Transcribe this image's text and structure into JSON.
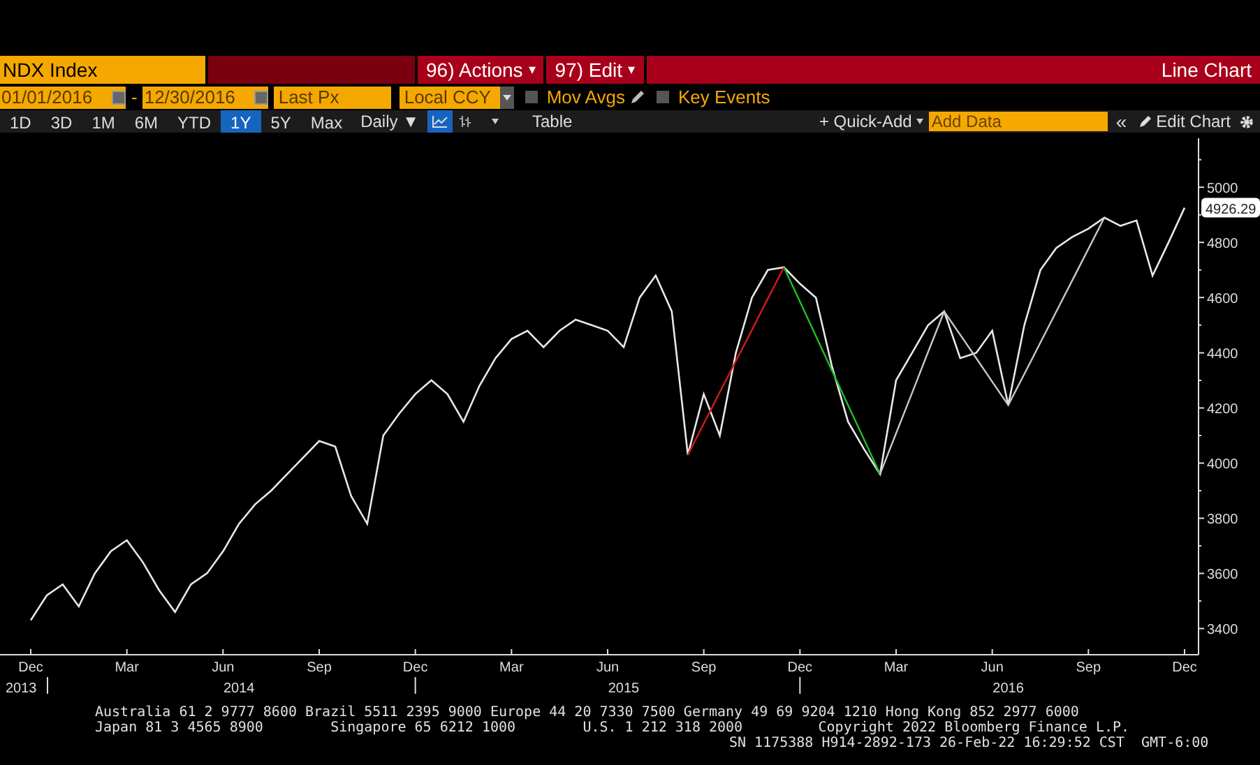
{
  "header": {
    "security": "NDX Index",
    "actions": "96) Actions",
    "edit": "97) Edit",
    "title": "Line Chart",
    "menu_caret": "▾"
  },
  "settings": {
    "start_date": "01/01/2016",
    "separator": "-",
    "end_date": "12/30/2016",
    "price_field": "Last Px",
    "currency": "Local CCY",
    "options": [
      {
        "label": "Mov Avgs",
        "checked": false
      },
      {
        "label": "Key Events",
        "checked": false
      }
    ]
  },
  "toolbar": {
    "ranges": [
      {
        "label": "1D",
        "selected": false
      },
      {
        "label": "3D",
        "selected": false
      },
      {
        "label": "1M",
        "selected": false
      },
      {
        "label": "6M",
        "selected": false
      },
      {
        "label": "YTD",
        "selected": false
      },
      {
        "label": "1Y",
        "selected": true
      },
      {
        "label": "5Y",
        "selected": false
      },
      {
        "label": "Max",
        "selected": false
      }
    ],
    "frequency": "Daily ▼",
    "chart_types": [
      {
        "kind": "line",
        "selected": true
      },
      {
        "kind": "bar",
        "selected": false
      }
    ],
    "table": "Table",
    "quick_add": "+ Quick-Add",
    "add_data": {
      "placeholder": "Add Data"
    },
    "collapse": "«",
    "edit_chart": "Edit Chart"
  },
  "chart": {
    "last_value_label": "4926.29",
    "year_labels": [
      "2013",
      "2014",
      "2015",
      "2016"
    ],
    "chart_data": {
      "type": "line",
      "ylim": [
        3305,
        5178
      ],
      "categories": [
        "Dec",
        null,
        null,
        null,
        null,
        null,
        "Mar",
        null,
        null,
        null,
        null,
        null,
        "Jun",
        null,
        null,
        null,
        null,
        null,
        "Sep",
        null,
        null,
        null,
        null,
        null,
        "Dec",
        null,
        null,
        null,
        null,
        null,
        "Mar",
        null,
        null,
        null,
        null,
        null,
        "Jun",
        null,
        null,
        null,
        null,
        null,
        "Sep",
        null,
        null,
        null,
        null,
        null,
        "Dec",
        null,
        null,
        null,
        null,
        null,
        "Mar",
        null,
        null,
        null,
        null,
        null,
        "Jun",
        null,
        null,
        null,
        null,
        null,
        "Sep",
        null,
        null,
        null,
        null,
        null,
        "Dec"
      ],
      "yticks": [
        3400,
        3600,
        3800,
        4000,
        4200,
        4400,
        4600,
        4800,
        5000
      ],
      "series": [
        {
          "color": "#e8e8e8",
          "values": [
            3430,
            3520,
            3560,
            3480,
            3600,
            3680,
            3720,
            3640,
            3540,
            3460,
            3560,
            3600,
            3680,
            3780,
            3850,
            3900,
            3960,
            4020,
            4080,
            4060,
            3880,
            3780,
            4100,
            4180,
            4250,
            4300,
            4250,
            4150,
            4280,
            4380,
            4450,
            4480,
            4420,
            4480,
            4520,
            4500,
            4480,
            4420,
            4600,
            4680,
            4550,
            4030,
            4250,
            4100,
            4400,
            4600,
            4700,
            4710,
            4650,
            4600,
            4350,
            4150,
            4050,
            3960,
            4300,
            4400,
            4500,
            4550,
            4380,
            4400,
            4480,
            4210,
            4500,
            4700,
            4780,
            4820,
            4850,
            4890,
            4860,
            4880,
            4680,
            4800,
            4926
          ]
        },
        {
          "color": "#d01c1c",
          "values": [
            null,
            null,
            null,
            null,
            null,
            null,
            null,
            null,
            null,
            null,
            null,
            null,
            null,
            null,
            null,
            null,
            null,
            null,
            null,
            null,
            null,
            null,
            null,
            null,
            null,
            null,
            null,
            null,
            null,
            null,
            null,
            null,
            null,
            null,
            null,
            null,
            null,
            null,
            null,
            null,
            null,
            4030,
            4143,
            4257,
            4370,
            4483,
            4597,
            4710,
            null,
            null,
            null,
            null,
            null,
            null,
            null,
            null,
            null,
            null,
            null,
            null,
            null,
            null,
            null,
            null,
            null,
            null,
            null,
            null,
            null,
            null,
            null,
            null,
            null
          ]
        },
        {
          "color": "#1fbf2a",
          "values": [
            null,
            null,
            null,
            null,
            null,
            null,
            null,
            null,
            null,
            null,
            null,
            null,
            null,
            null,
            null,
            null,
            null,
            null,
            null,
            null,
            null,
            null,
            null,
            null,
            null,
            null,
            null,
            null,
            null,
            null,
            null,
            null,
            null,
            null,
            null,
            null,
            null,
            null,
            null,
            null,
            null,
            null,
            null,
            null,
            null,
            null,
            null,
            4710,
            4585,
            4460,
            4335,
            4210,
            4085,
            3960,
            null,
            null,
            null,
            null,
            null,
            null,
            null,
            null,
            null,
            null,
            null,
            null,
            null,
            null,
            null,
            null,
            null,
            null,
            null
          ]
        },
        {
          "color": "#c8c8c8",
          "values": [
            null,
            null,
            null,
            null,
            null,
            null,
            null,
            null,
            null,
            null,
            null,
            null,
            null,
            null,
            null,
            null,
            null,
            null,
            null,
            null,
            null,
            null,
            null,
            null,
            null,
            null,
            null,
            null,
            null,
            null,
            null,
            null,
            null,
            null,
            null,
            null,
            null,
            null,
            null,
            null,
            null,
            null,
            null,
            null,
            null,
            null,
            null,
            null,
            null,
            null,
            null,
            null,
            null,
            3960,
            4108,
            4255,
            4403,
            4550,
            4465,
            4380,
            4295,
            4210,
            4323,
            4437,
            4550,
            4663,
            4777,
            4890,
            null,
            null,
            null,
            null,
            null
          ]
        }
      ]
    }
  },
  "footer": [
    "Australia 61 2 9777 8600 Brazil 5511 2395 9000 Europe 44 20 7330 7500 Germany 49 69 9204 1210 Hong Kong 852 2977 6000",
    "Japan 81 3 4565 8900        Singapore 65 6212 1000        U.S. 1 212 318 2000         Copyright 2022 Bloomberg Finance L.P.",
    "SN 1175388 H914-2892-173 26-Feb-22 16:29:52 CST  GMT-6:00"
  ]
}
